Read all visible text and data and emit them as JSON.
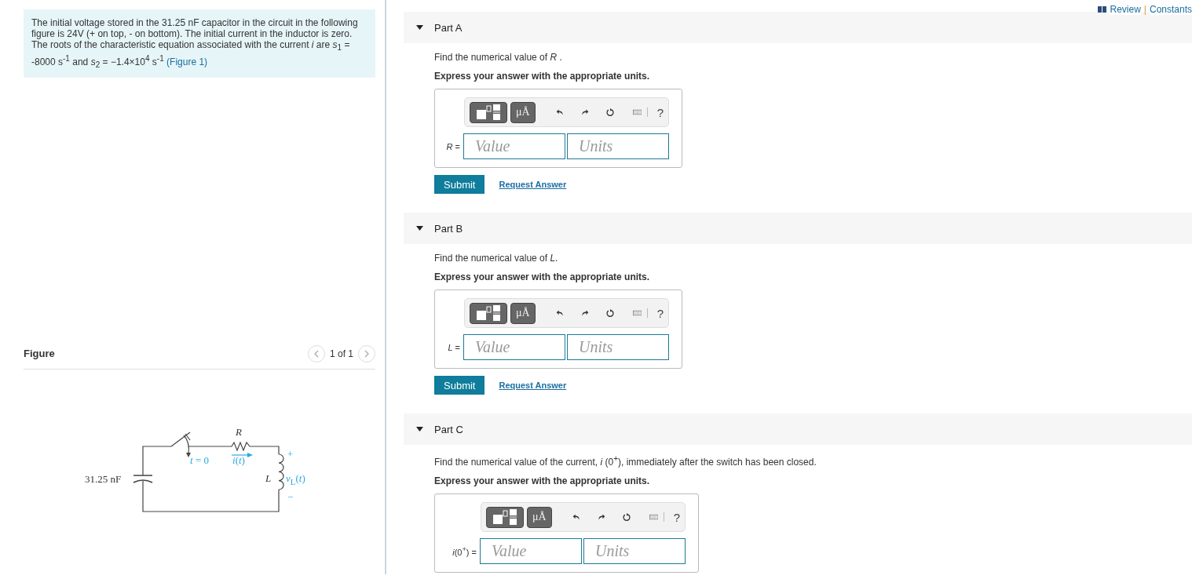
{
  "header": {
    "review": "Review",
    "separator": "|",
    "constants": "Constants"
  },
  "problem": {
    "text": "The initial voltage stored in the 31.25 nF capacitor in the circuit in the following figure is 24V (+ on top, - on bottom). The initial current in the inductor is zero. The roots of the characteristic equation associated with the current *i* are *s*$_{1}$ = -8000  s$^{-1}$ and *s*$_{2}$ = −1.4×10$^{4}$  s$^{-1}$",
    "link": "(Figure 1)"
  },
  "figure": {
    "title": "Figure",
    "pager": "1 of 1",
    "labels": [
      {
        "kind": "capacitor",
        "text": "31.25 nF"
      },
      {
        "kind": "resistor",
        "text": "*R*"
      },
      {
        "kind": "switch",
        "text": "*t* = 0"
      },
      {
        "kind": "current",
        "text": "*i*(*t*)"
      },
      {
        "kind": "plus",
        "text": "+"
      },
      {
        "kind": "inductor",
        "text": "*L*"
      },
      {
        "kind": "voltage",
        "text": "*v*$_{L}$(*t*)"
      },
      {
        "kind": "minus",
        "text": "−"
      }
    ]
  },
  "parts": [
    {
      "label": "Part A",
      "expanded": true,
      "question": "Find the numerical value of *R* .",
      "instruction": "Express your answer with the appropriate units.",
      "units_button": "μÅ",
      "help": "?",
      "answer_label": "*R* =",
      "value_placeholder": "Value",
      "units_placeholder": "Units",
      "submit": "Submit",
      "request": "Request Answer"
    },
    {
      "label": "Part B",
      "expanded": true,
      "question": "Find the numerical value of *L*.",
      "instruction": "Express your answer with the appropriate units.",
      "units_button": "μÅ",
      "help": "?",
      "answer_label": "*L* =",
      "value_placeholder": "Value",
      "units_placeholder": "Units",
      "submit": "Submit",
      "request": "Request Answer"
    },
    {
      "label": "Part C",
      "expanded": true,
      "question": "Find the numerical value of the current, *i* (0$^{+}$), immediately after the switch has been closed.",
      "instruction": "Express your answer with the appropriate units.",
      "units_button": "μÅ",
      "help": "?",
      "answer_label": "*i*(0$^{+}$) =",
      "value_placeholder": "Value",
      "units_placeholder": "Units"
    }
  ]
}
